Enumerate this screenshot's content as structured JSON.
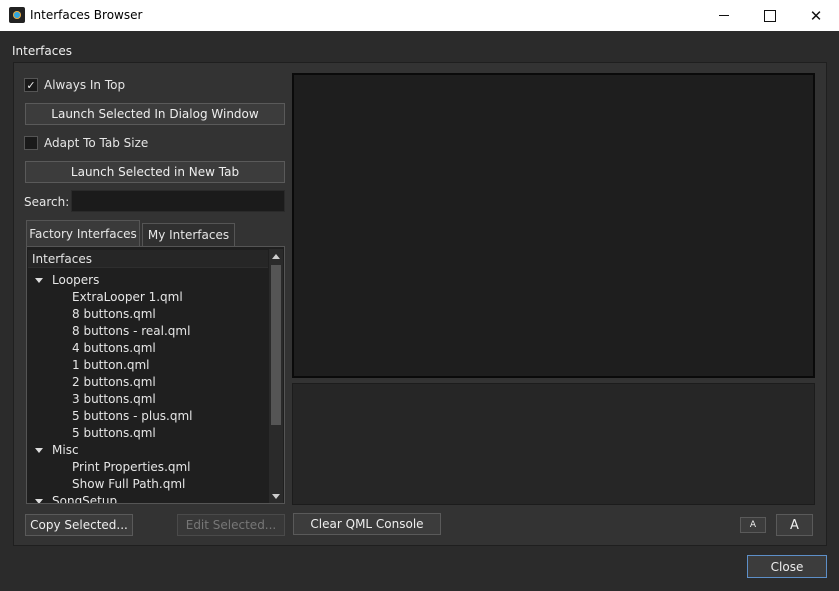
{
  "window": {
    "title": "Interfaces Browser",
    "icons": {
      "app": "app-icon",
      "minimize": "minimize-icon",
      "maximize": "maximize-icon",
      "close": "close-icon"
    }
  },
  "group": {
    "title": "Interfaces"
  },
  "options": {
    "always_on_top": {
      "label": "Always In Top",
      "checked": true
    },
    "launch_dialog_label": "Launch Selected In Dialog Window",
    "adapt_tab": {
      "label": "Adapt To Tab Size",
      "checked": false
    },
    "launch_tab_label": "Launch Selected in New Tab"
  },
  "search": {
    "label": "Search:",
    "value": "",
    "placeholder": ""
  },
  "tabs": [
    {
      "label": "Factory Interfaces",
      "active": true
    },
    {
      "label": "My Interfaces",
      "active": false
    }
  ],
  "tree": {
    "header": "Interfaces",
    "rows": [
      {
        "label": "Loopers",
        "level": 0,
        "expanded": true
      },
      {
        "label": "ExtraLooper 1.qml",
        "level": 1
      },
      {
        "label": "8 buttons.qml",
        "level": 1
      },
      {
        "label": "8 buttons - real.qml",
        "level": 1
      },
      {
        "label": "4 buttons.qml",
        "level": 1
      },
      {
        "label": "1 button.qml",
        "level": 1
      },
      {
        "label": "2 buttons.qml",
        "level": 1
      },
      {
        "label": "3 buttons.qml",
        "level": 1
      },
      {
        "label": "5 buttons - plus.qml",
        "level": 1
      },
      {
        "label": "5 buttons.qml",
        "level": 1
      },
      {
        "label": "Misc",
        "level": 0,
        "expanded": true
      },
      {
        "label": "Print Properties.qml",
        "level": 1
      },
      {
        "label": "Show Full Path.qml",
        "level": 1
      },
      {
        "label": "SongSetup",
        "level": 0,
        "expanded": true
      }
    ]
  },
  "buttons": {
    "copy_selected": "Copy Selected...",
    "edit_selected": "Edit Selected...",
    "clear_console": "Clear QML Console",
    "font_small": "A",
    "font_large": "A",
    "close": "Close"
  }
}
